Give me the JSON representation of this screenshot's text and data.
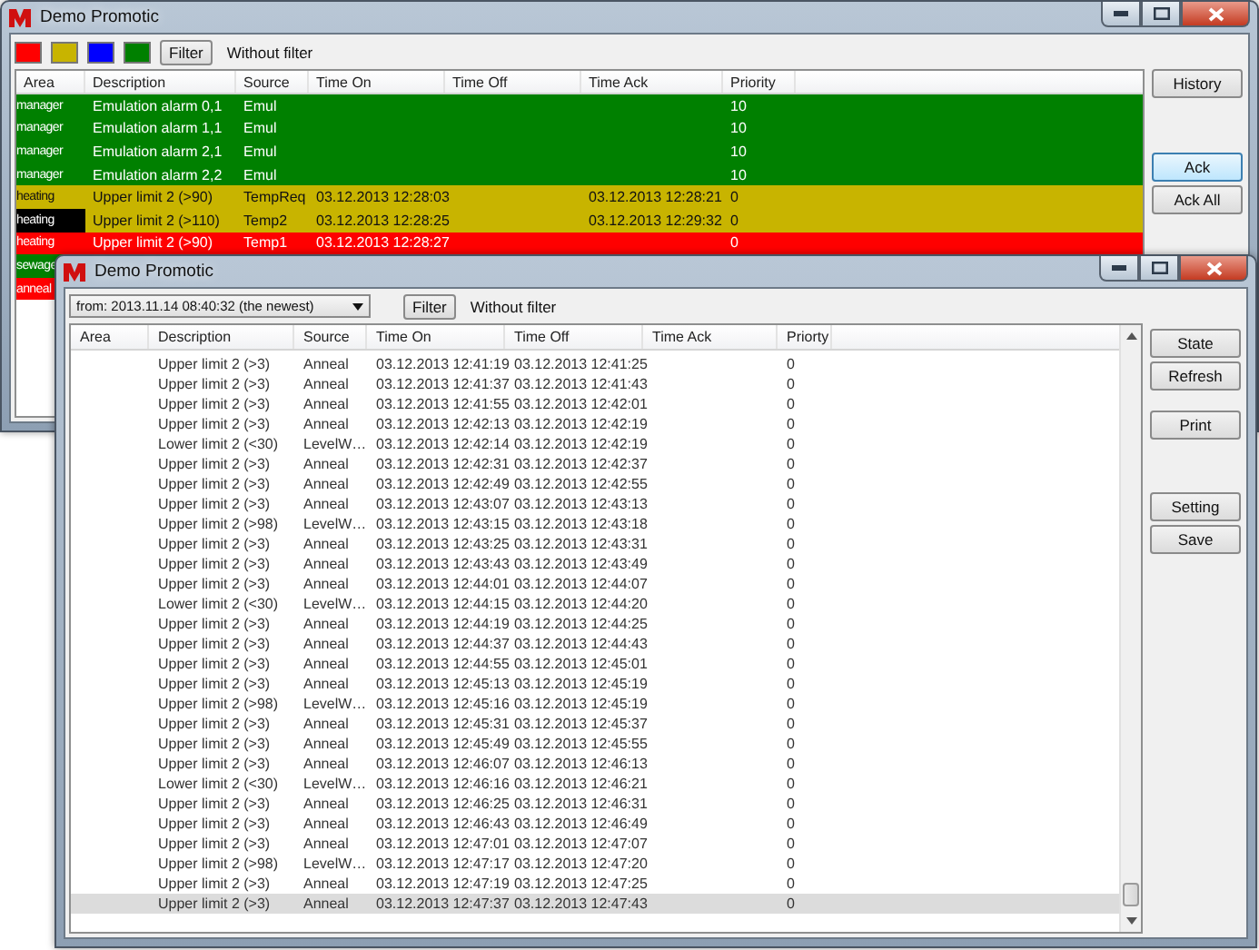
{
  "main_window": {
    "title": "Demo Promotic",
    "color_filters": [
      {
        "color": "#ff0000"
      },
      {
        "color": "#c8b400"
      },
      {
        "color": "#0000ff"
      },
      {
        "color": "#008000"
      }
    ],
    "filter_button": "Filter",
    "filter_text": "Without filter",
    "columns": [
      "Area",
      "Description",
      "Source",
      "Time On",
      "Time Off",
      "Time Ack",
      "Priority"
    ],
    "rows": [
      {
        "area": "manager",
        "description": "Emulation alarm 0,1",
        "source": "Emul",
        "priority": "10",
        "color": "#008000",
        "highlighted": false
      },
      {
        "area": "manager",
        "description": "Emulation alarm 1,1",
        "source": "Emul",
        "priority": "10",
        "color": "#008000",
        "highlighted": false
      },
      {
        "area": "manager",
        "description": "Emulation alarm 2,1",
        "source": "Emul",
        "priority": "10",
        "color": "#008000",
        "highlighted": false
      },
      {
        "area": "manager",
        "description": "Emulation alarm 2,2",
        "source": "Emul",
        "priority": "10",
        "color": "#008000",
        "highlighted": false
      },
      {
        "area": "heating",
        "description": "Upper limit 2 (>90)",
        "source": "TempReq",
        "time_on": "03.12.2013 12:28:03",
        "time_ack": "03.12.2013 12:28:21",
        "priority": "0",
        "color": "#c8b400",
        "highlighted": false
      },
      {
        "area": "heating",
        "description": "Upper limit 2 (>110)",
        "source": "Temp2",
        "time_on": "03.12.2013 12:28:25",
        "time_ack": "03.12.2013 12:29:32",
        "priority": "0",
        "color": "#c8b400",
        "highlighted": true
      },
      {
        "area": "heating",
        "description": "Upper limit 2 (>90)",
        "source": "Temp1",
        "time_on": "03.12.2013 12:28:27",
        "priority": "0",
        "color": "#ff0000",
        "highlighted": false
      },
      {
        "area": "sewage",
        "color": "#008000",
        "highlighted": false
      },
      {
        "area": "anneal",
        "color": "#ff0000",
        "highlighted": false
      }
    ],
    "button_groups": [
      [
        {
          "label": "History",
          "focused": false
        }
      ],
      [
        {
          "label": "Ack",
          "focused": true
        },
        {
          "label": "Ack All",
          "focused": false
        }
      ]
    ]
  },
  "history_window": {
    "title": "Demo Promotic",
    "range_select": "from: 2013.11.14 08:40:32 (the newest)",
    "filter_button": "Filter",
    "filter_text": "Without filter",
    "columns": [
      "Area",
      "Description",
      "Source",
      "Time On",
      "Time Off",
      "Time Ack",
      "Priorty"
    ],
    "rows": [
      {
        "description": "Upper limit 2 (>3)",
        "source": "Anneal",
        "time_on": "03.12.2013 12:41:19",
        "time_off": "03.12.2013 12:41:25",
        "priority": "0",
        "selected": false
      },
      {
        "description": "Upper limit 2 (>3)",
        "source": "Anneal",
        "time_on": "03.12.2013 12:41:37",
        "time_off": "03.12.2013 12:41:43",
        "priority": "0",
        "selected": false
      },
      {
        "description": "Upper limit 2 (>3)",
        "source": "Anneal",
        "time_on": "03.12.2013 12:41:55",
        "time_off": "03.12.2013 12:42:01",
        "priority": "0",
        "selected": false
      },
      {
        "description": "Upper limit 2 (>3)",
        "source": "Anneal",
        "time_on": "03.12.2013 12:42:13",
        "time_off": "03.12.2013 12:42:19",
        "priority": "0",
        "selected": false
      },
      {
        "description": "Lower limit 2 (<30)",
        "source": "LevelW…",
        "time_on": "03.12.2013 12:42:14",
        "time_off": "03.12.2013 12:42:19",
        "priority": "0",
        "selected": false
      },
      {
        "description": "Upper limit 2 (>3)",
        "source": "Anneal",
        "time_on": "03.12.2013 12:42:31",
        "time_off": "03.12.2013 12:42:37",
        "priority": "0",
        "selected": false
      },
      {
        "description": "Upper limit 2 (>3)",
        "source": "Anneal",
        "time_on": "03.12.2013 12:42:49",
        "time_off": "03.12.2013 12:42:55",
        "priority": "0",
        "selected": false
      },
      {
        "description": "Upper limit 2 (>3)",
        "source": "Anneal",
        "time_on": "03.12.2013 12:43:07",
        "time_off": "03.12.2013 12:43:13",
        "priority": "0",
        "selected": false
      },
      {
        "description": "Upper limit 2 (>98)",
        "source": "LevelW…",
        "time_on": "03.12.2013 12:43:15",
        "time_off": "03.12.2013 12:43:18",
        "priority": "0",
        "selected": false
      },
      {
        "description": "Upper limit 2 (>3)",
        "source": "Anneal",
        "time_on": "03.12.2013 12:43:25",
        "time_off": "03.12.2013 12:43:31",
        "priority": "0",
        "selected": false
      },
      {
        "description": "Upper limit 2 (>3)",
        "source": "Anneal",
        "time_on": "03.12.2013 12:43:43",
        "time_off": "03.12.2013 12:43:49",
        "priority": "0",
        "selected": false
      },
      {
        "description": "Upper limit 2 (>3)",
        "source": "Anneal",
        "time_on": "03.12.2013 12:44:01",
        "time_off": "03.12.2013 12:44:07",
        "priority": "0",
        "selected": false
      },
      {
        "description": "Lower limit 2 (<30)",
        "source": "LevelW…",
        "time_on": "03.12.2013 12:44:15",
        "time_off": "03.12.2013 12:44:20",
        "priority": "0",
        "selected": false
      },
      {
        "description": "Upper limit 2 (>3)",
        "source": "Anneal",
        "time_on": "03.12.2013 12:44:19",
        "time_off": "03.12.2013 12:44:25",
        "priority": "0",
        "selected": false
      },
      {
        "description": "Upper limit 2 (>3)",
        "source": "Anneal",
        "time_on": "03.12.2013 12:44:37",
        "time_off": "03.12.2013 12:44:43",
        "priority": "0",
        "selected": false
      },
      {
        "description": "Upper limit 2 (>3)",
        "source": "Anneal",
        "time_on": "03.12.2013 12:44:55",
        "time_off": "03.12.2013 12:45:01",
        "priority": "0",
        "selected": false
      },
      {
        "description": "Upper limit 2 (>3)",
        "source": "Anneal",
        "time_on": "03.12.2013 12:45:13",
        "time_off": "03.12.2013 12:45:19",
        "priority": "0",
        "selected": false
      },
      {
        "description": "Upper limit 2 (>98)",
        "source": "LevelW…",
        "time_on": "03.12.2013 12:45:16",
        "time_off": "03.12.2013 12:45:19",
        "priority": "0",
        "selected": false
      },
      {
        "description": "Upper limit 2 (>3)",
        "source": "Anneal",
        "time_on": "03.12.2013 12:45:31",
        "time_off": "03.12.2013 12:45:37",
        "priority": "0",
        "selected": false
      },
      {
        "description": "Upper limit 2 (>3)",
        "source": "Anneal",
        "time_on": "03.12.2013 12:45:49",
        "time_off": "03.12.2013 12:45:55",
        "priority": "0",
        "selected": false
      },
      {
        "description": "Upper limit 2 (>3)",
        "source": "Anneal",
        "time_on": "03.12.2013 12:46:07",
        "time_off": "03.12.2013 12:46:13",
        "priority": "0",
        "selected": false
      },
      {
        "description": "Lower limit 2 (<30)",
        "source": "LevelW…",
        "time_on": "03.12.2013 12:46:16",
        "time_off": "03.12.2013 12:46:21",
        "priority": "0",
        "selected": false
      },
      {
        "description": "Upper limit 2 (>3)",
        "source": "Anneal",
        "time_on": "03.12.2013 12:46:25",
        "time_off": "03.12.2013 12:46:31",
        "priority": "0",
        "selected": false
      },
      {
        "description": "Upper limit 2 (>3)",
        "source": "Anneal",
        "time_on": "03.12.2013 12:46:43",
        "time_off": "03.12.2013 12:46:49",
        "priority": "0",
        "selected": false
      },
      {
        "description": "Upper limit 2 (>3)",
        "source": "Anneal",
        "time_on": "03.12.2013 12:47:01",
        "time_off": "03.12.2013 12:47:07",
        "priority": "0",
        "selected": false
      },
      {
        "description": "Upper limit 2 (>98)",
        "source": "LevelW…",
        "time_on": "03.12.2013 12:47:17",
        "time_off": "03.12.2013 12:47:20",
        "priority": "0",
        "selected": false
      },
      {
        "description": "Upper limit 2 (>3)",
        "source": "Anneal",
        "time_on": "03.12.2013 12:47:19",
        "time_off": "03.12.2013 12:47:25",
        "priority": "0",
        "selected": false
      },
      {
        "description": "Upper limit 2 (>3)",
        "source": "Anneal",
        "time_on": "03.12.2013 12:47:37",
        "time_off": "03.12.2013 12:47:43",
        "priority": "0",
        "selected": true
      }
    ],
    "button_groups": [
      [
        {
          "label": "State",
          "focused": false
        },
        {
          "label": "Refresh",
          "focused": false
        }
      ],
      [
        {
          "label": "Print",
          "focused": false
        }
      ],
      [
        {
          "label": "Setting",
          "focused": false
        },
        {
          "label": "Save",
          "focused": false
        }
      ]
    ]
  }
}
